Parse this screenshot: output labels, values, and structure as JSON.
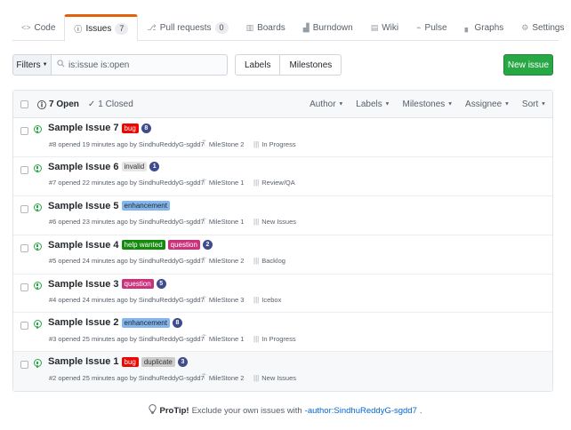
{
  "reponav": {
    "tabs": [
      {
        "icon": "<>",
        "label": "Code",
        "count": ""
      },
      {
        "icon": "ⓘ",
        "label": "Issues",
        "count": "7"
      },
      {
        "icon": "⎇",
        "label": "Pull requests",
        "count": "0"
      },
      {
        "icon": "▥",
        "label": "Boards",
        "count": ""
      },
      {
        "icon": "▟",
        "label": "Burndown",
        "count": ""
      },
      {
        "icon": "▤",
        "label": "Wiki",
        "count": ""
      },
      {
        "icon": "⌁",
        "label": "Pulse",
        "count": ""
      },
      {
        "icon": "▖",
        "label": "Graphs",
        "count": ""
      },
      {
        "icon": "⚙",
        "label": "Settings",
        "count": ""
      }
    ],
    "selected": "Issues"
  },
  "subnav": {
    "filters_label": "Filters",
    "search_value": "is:issue is:open",
    "labels_label": "Labels",
    "milestones_label": "Milestones",
    "new_issue_label": "New issue"
  },
  "header": {
    "open_label": "7 Open",
    "closed_label": "1 Closed",
    "menus": [
      "Author",
      "Labels",
      "Milestones",
      "Assignee",
      "Sort"
    ]
  },
  "issues": [
    {
      "title": "Sample Issue 7",
      "labels": [
        "bug"
      ],
      "badge": "8",
      "opened": "#8 opened 19 minutes ago by SindhuReddyG-sgdd7",
      "milestone": "MileStone 2",
      "project": "In Progress"
    },
    {
      "title": "Sample Issue 6",
      "labels": [
        "invalid"
      ],
      "badge": "1",
      "opened": "#7 opened 22 minutes ago by SindhuReddyG-sgdd7",
      "milestone": "MileStone 1",
      "project": "Review/QA"
    },
    {
      "title": "Sample Issue 5",
      "labels": [
        "enhancement"
      ],
      "badge": "",
      "opened": "#6 opened 23 minutes ago by SindhuReddyG-sgdd7",
      "milestone": "MileStone 1",
      "project": "New Issues"
    },
    {
      "title": "Sample Issue 4",
      "labels": [
        "help wanted",
        "question"
      ],
      "badge": "2",
      "opened": "#5 opened 24 minutes ago by SindhuReddyG-sgdd7",
      "milestone": "MileStone 2",
      "project": "Backlog"
    },
    {
      "title": "Sample Issue 3",
      "labels": [
        "question"
      ],
      "badge": "5",
      "opened": "#4 opened 24 minutes ago by SindhuReddyG-sgdd7",
      "milestone": "MileStone 3",
      "project": "Icebox"
    },
    {
      "title": "Sample Issue 2",
      "labels": [
        "enhancement"
      ],
      "badge": "8",
      "opened": "#3 opened 25 minutes ago by SindhuReddyG-sgdd7",
      "milestone": "MileStone 1",
      "project": "In Progress"
    },
    {
      "title": "Sample Issue 1",
      "labels": [
        "bug",
        "duplicate"
      ],
      "badge": "3",
      "opened": "#2 opened 25 minutes ago by SindhuReddyG-sgdd7",
      "milestone": "MileStone 2",
      "project": "New Issues"
    }
  ],
  "protip": {
    "prefix": "ProTip!",
    "text": "Exclude your own issues with",
    "link": "-author:SindhuReddyG-sgdd7",
    "suffix": "."
  },
  "colors": {
    "accent_tab": "#e36209",
    "new_issue": "#28a745",
    "open_icon": "#28a745",
    "badge": "#3e4c8c"
  }
}
